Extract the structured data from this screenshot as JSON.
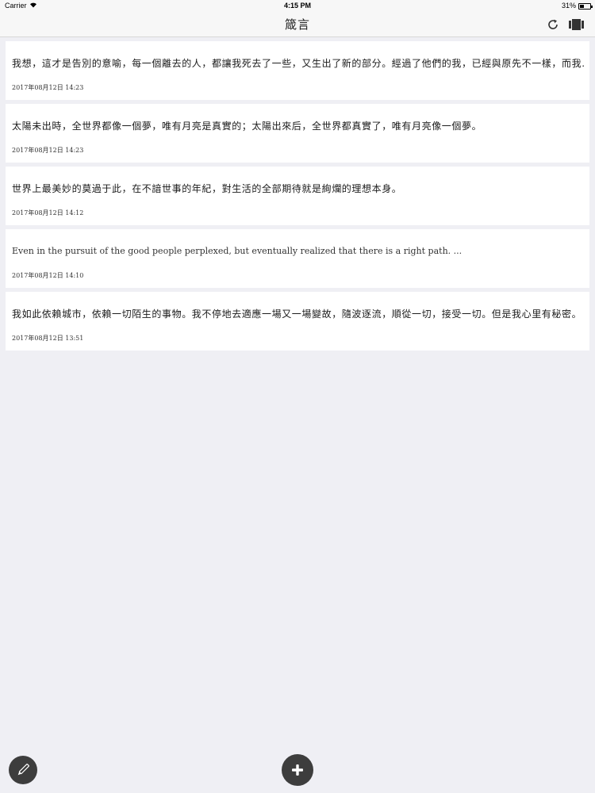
{
  "status_bar": {
    "carrier": "Carrier",
    "time": "4:15 PM",
    "battery": "31%"
  },
  "nav": {
    "title": "箴言"
  },
  "entries": [
    {
      "text": "我想，這才是告別的意喻，每一個離去的人，都讓我死去了一些，又生出了新的部分。經過了他們的我，已經與原先不一樣，而我...",
      "date": "2017年08月12日 14:23"
    },
    {
      "text": "太陽未出時，全世界都像一個夢，唯有月亮是真實的；太陽出來后，全世界都真實了，唯有月亮像一個夢。",
      "date": "2017年08月12日 14:23"
    },
    {
      "text": "世界上最美妙的莫過于此，在不諳世事的年紀，對生活的全部期待就是絢爛的理想本身。",
      "date": "2017年08月12日 14:12"
    },
    {
      "text": "Even in the pursuit of the good people perplexed, but eventually realized that there is a right path. ...",
      "date": "2017年08月12日 14:10"
    },
    {
      "text": "我如此依賴城市，依賴一切陌生的事物。我不停地去適應一場又一場變故，隨波逐流，順從一切，接受一切。但是我心里有秘密。",
      "date": "2017年08月12日 13:51"
    }
  ],
  "icons": {
    "refresh": "refresh-icon",
    "cards": "cards-icon",
    "edit": "pencil-icon",
    "add": "plus-icon"
  },
  "colors": {
    "background": "#efeff4",
    "card": "#ffffff",
    "fab": "#3d3d3d"
  }
}
